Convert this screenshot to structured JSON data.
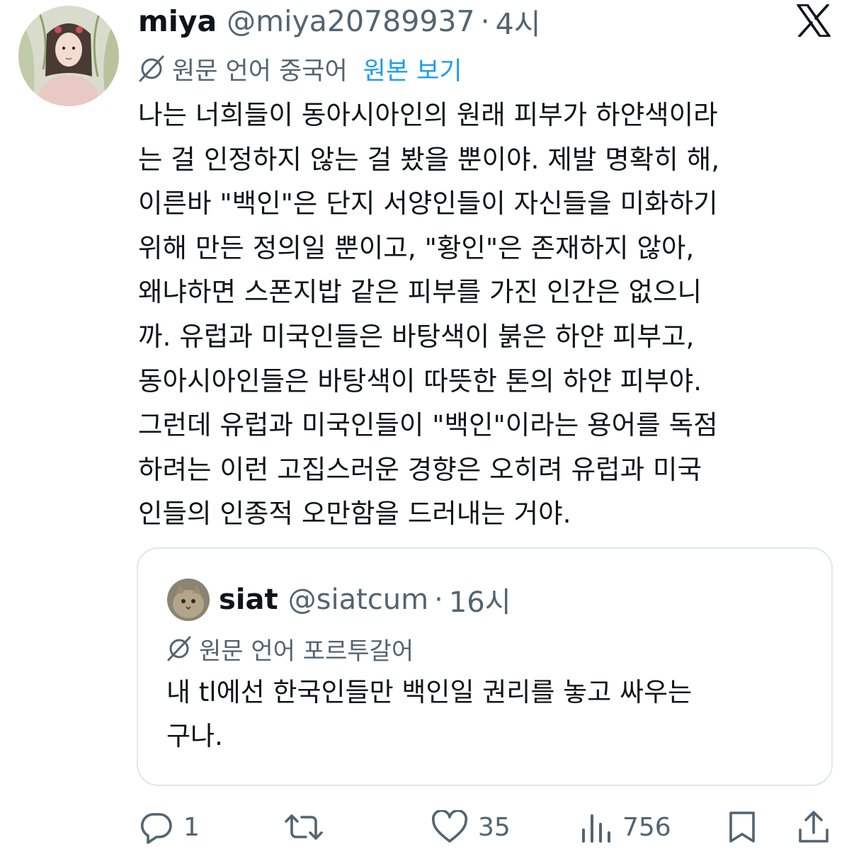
{
  "tweet": {
    "display_name": "miya",
    "handle": "@miya20789937",
    "separator": "·",
    "time": "4시",
    "translation_label": "원문 언어 중국어",
    "show_original": "원본 보기",
    "text_lines": [
      "나는 너희들이 동아시아인의 원래 피부가 하얀색이라",
      "는 걸 인정하지 않는 걸 봤을 뿐이야. 제발 명확히 해,",
      "이른바 \"백인\"은 단지 서양인들이 자신들을 미화하기",
      "위해 만든 정의일 뿐이고, \"황인\"은 존재하지 않아,",
      "왜냐하면 스폰지밥 같은 피부를 가진 인간은 없으니",
      "까. 유럽과 미국인들은 바탕색이 붉은 하얀 피부고,",
      "동아시아인들은 바탕색이 따뜻한 톤의 하얀 피부야.",
      "그런데 유럽과 미국인들이 \"백인\"이라는 용어를 독점",
      "하려는 이런 고집스러운 경향은 오히려 유럽과 미국",
      "인들의 인종적 오만함을 드러내는 거야."
    ]
  },
  "quoted": {
    "display_name": "siat",
    "handle": "@siatcum",
    "separator": "·",
    "time": "16시",
    "translation_label": "원문 언어 포르투갈어",
    "text_lines": [
      "내 tl에선 한국인들만 백인일 권리를 놓고 싸우는",
      "구나."
    ]
  },
  "actions": {
    "replies": "1",
    "reposts": "",
    "likes": "35",
    "views": "756"
  },
  "colors": {
    "text": "#0f1419",
    "secondary": "#536471",
    "link": "#1d9bf0",
    "border": "#e1e6ea"
  },
  "icons": [
    "x-logo-icon",
    "translate-globe-icon",
    "reply-icon",
    "repost-icon",
    "like-icon",
    "views-icon",
    "bookmark-icon",
    "share-icon"
  ]
}
